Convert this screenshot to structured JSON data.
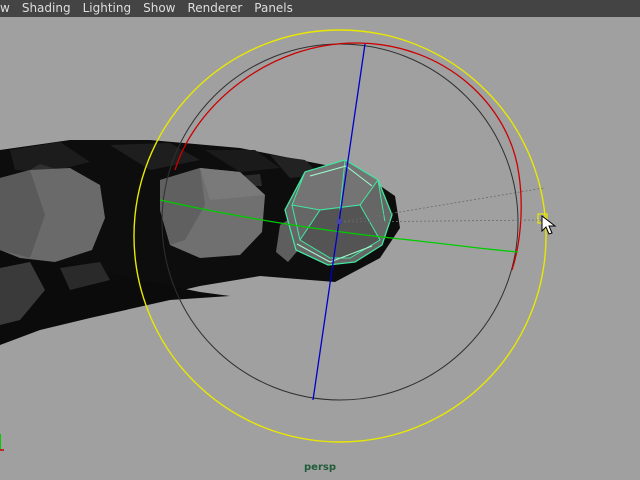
{
  "menubar": {
    "items": [
      {
        "label": "w",
        "partial": true
      },
      {
        "label": "Shading"
      },
      {
        "label": "Lighting"
      },
      {
        "label": "Show"
      },
      {
        "label": "Renderer"
      },
      {
        "label": "Panels"
      }
    ]
  },
  "viewport": {
    "camera_name": "persp",
    "background_color": "#a0a0a0",
    "manipulator": {
      "type": "rotate-manipulator",
      "x_axis_color": "#cc0000",
      "y_axis_color": "#00cc00",
      "z_axis_color": "#0000cc",
      "view_ring_color": "#e8e800"
    },
    "selection_wireframe_color": "#40e8a0",
    "cursor_icon": "arrow-cursor-icon",
    "axis_icon": "world-axis-icon"
  }
}
